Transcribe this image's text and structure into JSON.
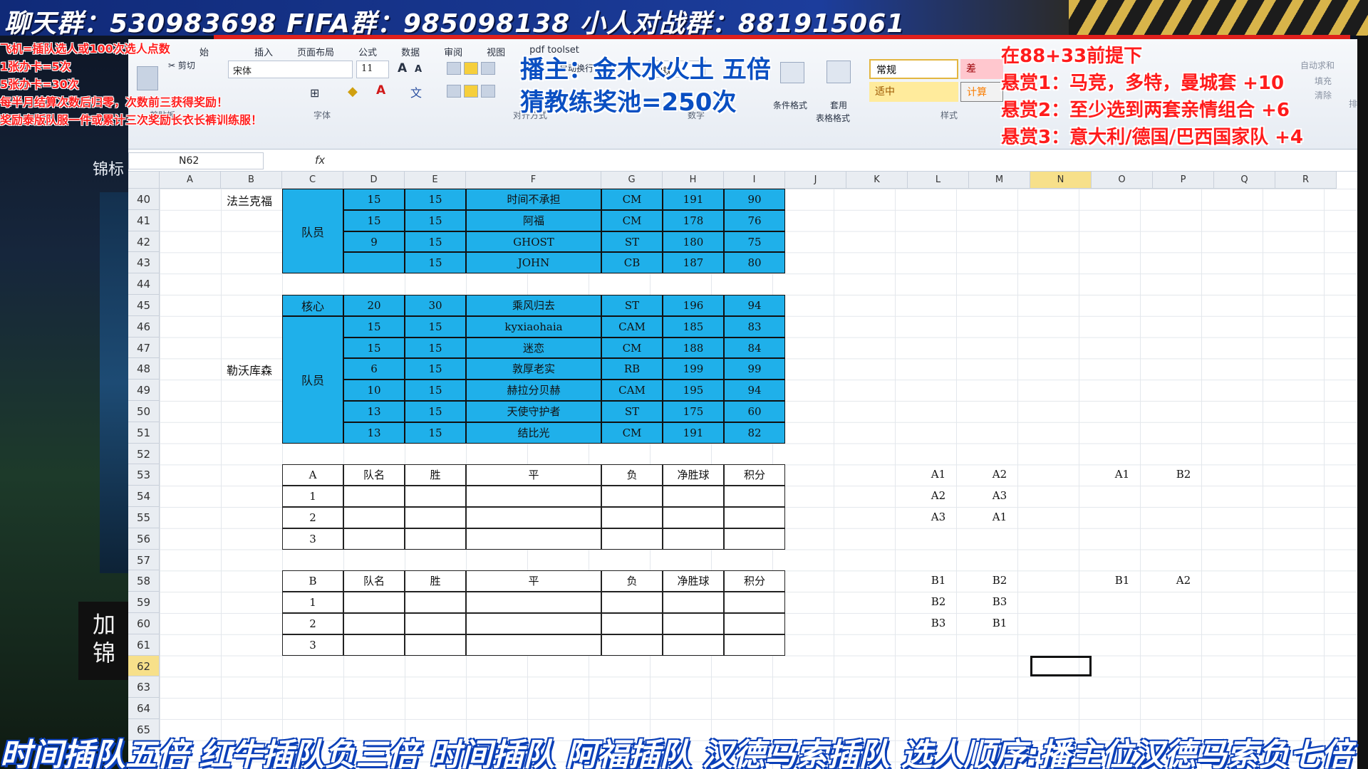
{
  "banner": {
    "text": "聊天群：530983698   FIFA群：985098138   小人对战群：8819150​61"
  },
  "left_overlay": {
    "lines": [
      "飞机=插队选人或100次选人点数",
      "1张办卡=5次",
      "5张办卡=30次",
      "每半月结算次数后归零，次数前三获得奖励！",
      "奖励泰版队服一件或累计三次奖励长衣长裤训练服！"
    ]
  },
  "host_overlay": {
    "line1": "播主：金木水火土 五倍",
    "line2": "猜教练奖池=250次"
  },
  "bounty_overlay": {
    "lines": [
      "在88+33前提下",
      "悬赏1：马竞，多特，曼城套 +10",
      "悬赏2：至少选到两套亲情组合 +6",
      "悬赏3：意大利/德国/巴西国家队 +4"
    ]
  },
  "background": {
    "side_text": "锦标",
    "box_lines": [
      "加",
      "锦"
    ]
  },
  "bottom_ticker": {
    "text": "时间插队五倍 红牛插队负三倍 时间插队 阿福插队 汉德马索插队 选人顺序:播主位汉德马索负七倍"
  },
  "ribbon": {
    "tabs": [
      "插入",
      "页面布局",
      "公式",
      "数据",
      "审阅",
      "视图",
      "pdf toolset"
    ],
    "first_tab_partial": "始",
    "cut_label": "剪切",
    "font_name": "宋体",
    "font_size": "11",
    "groups": {
      "clipboard": "剪贴板",
      "font": "字体",
      "align": "对齐方式",
      "number": "数字",
      "styles": "样式"
    },
    "number_format": "常规",
    "number_format_small": "常规",
    "wrap_label": "自动换行",
    "cond_format": "条件格式",
    "table_format_1": "套用",
    "table_format_2": "表格格式",
    "style_normal": "常规",
    "style_bad": "差",
    "style_neutral": "适中",
    "style_calc": "计算",
    "auto_sum": "自动求和",
    "fill": "填充",
    "clear": "清除",
    "sort": "排",
    "font_grow": "A",
    "font_shrink": "A",
    "font_color": "A",
    "fx": "fx"
  },
  "formula_bar": {
    "cell_ref": "N62",
    "content": ""
  },
  "columns": [
    "A",
    "B",
    "C",
    "D",
    "E",
    "F",
    "G",
    "H",
    "I",
    "J",
    "K",
    "L",
    "M",
    "N",
    "O",
    "P",
    "Q",
    "R"
  ],
  "rows": [
    "40",
    "41",
    "42",
    "43",
    "44",
    "45",
    "46",
    "47",
    "48",
    "49",
    "50",
    "51",
    "52",
    "53",
    "54",
    "55",
    "56",
    "57",
    "58",
    "59",
    "60",
    "61",
    "62",
    "63",
    "64",
    "65"
  ],
  "selected": {
    "col": "N",
    "row": "62"
  },
  "team1": {
    "name": "法兰克福",
    "role": "队员",
    "players": [
      [
        "15",
        "15",
        "时间不承担",
        "CM",
        "191",
        "90"
      ],
      [
        "15",
        "15",
        "阿福",
        "CM",
        "178",
        "76"
      ],
      [
        "9",
        "15",
        "GHOST",
        "ST",
        "180",
        "75"
      ],
      [
        "",
        "15",
        "JOHN",
        "CB",
        "187",
        "80"
      ]
    ]
  },
  "team2": {
    "name": "勒沃库森",
    "core_role": "核心",
    "role": "队员",
    "core": [
      "20",
      "30",
      "乘风归去",
      "ST",
      "196",
      "94"
    ],
    "players": [
      [
        "15",
        "15",
        "kyxiaohaia",
        "CAM",
        "185",
        "83"
      ],
      [
        "15",
        "15",
        "迷恋",
        "CM",
        "188",
        "84"
      ],
      [
        "6",
        "15",
        "敦厚老实",
        "RB",
        "199",
        "99"
      ],
      [
        "10",
        "15",
        "赫拉分贝赫",
        "CAM",
        "195",
        "94"
      ],
      [
        "13",
        "15",
        "天使守护者",
        "ST",
        "175",
        "60"
      ],
      [
        "13",
        "15",
        "结比光",
        "CM",
        "191",
        "82"
      ]
    ]
  },
  "groupA": {
    "header": [
      "A",
      "队名",
      "胜",
      "平",
      "负",
      "净胜球",
      "积分"
    ],
    "rows": [
      "1",
      "2",
      "3"
    ]
  },
  "groupB": {
    "header": [
      "B",
      "队名",
      "胜",
      "平",
      "负",
      "净胜球",
      "积分"
    ],
    "rows": [
      "1",
      "2",
      "3"
    ]
  },
  "pairsA": [
    [
      "A1",
      "A2"
    ],
    [
      "A2",
      "A3"
    ],
    [
      "A3",
      "A1"
    ]
  ],
  "pairsB": [
    [
      "B1",
      "B2"
    ],
    [
      "B2",
      "B3"
    ],
    [
      "B3",
      "B1"
    ]
  ],
  "cross": {
    "a": [
      "A1",
      "B2"
    ],
    "b": [
      "B1",
      "A2"
    ]
  }
}
